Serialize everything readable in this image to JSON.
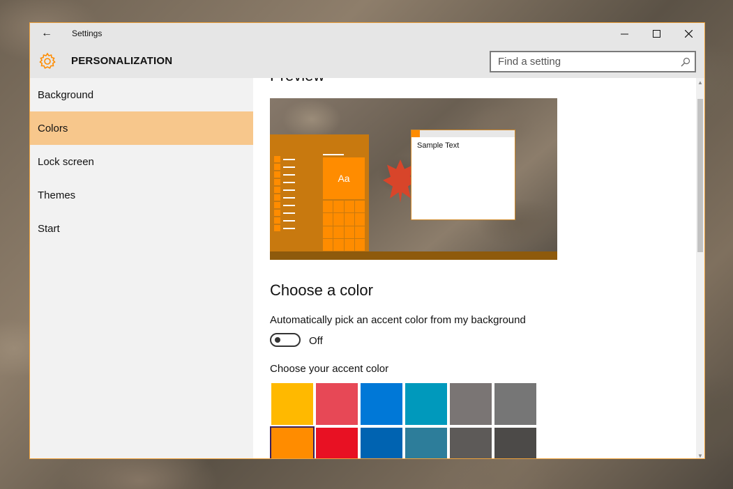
{
  "window": {
    "title": "Settings",
    "back_icon": "←",
    "controls": {
      "minimize": "—",
      "maximize": "☐",
      "close": "✕"
    }
  },
  "header": {
    "section": "PERSONALIZATION",
    "icon": "gear-icon",
    "search_placeholder": "Find a setting"
  },
  "sidebar": {
    "items": [
      {
        "label": "Background"
      },
      {
        "label": "Colors",
        "active": true
      },
      {
        "label": "Lock screen"
      },
      {
        "label": "Themes"
      },
      {
        "label": "Start"
      }
    ]
  },
  "content": {
    "preview_heading": "Preview",
    "preview_tile_text": "Aa",
    "sample_text": "Sample Text",
    "choose_heading": "Choose a color",
    "auto_pick_label": "Automatically pick an accent color from my background",
    "toggle_state": "Off",
    "accent_label": "Choose your accent color"
  },
  "accent_colors": {
    "accent": "#ff8c00",
    "swatches": [
      "#ffb900",
      "#e74856",
      "#0078d7",
      "#0099bc",
      "#7a7574",
      "#767676",
      "#ff8c00",
      "#e81123",
      "#0063b1",
      "#2d7d9a",
      "#5d5a58",
      "#4c4a48"
    ],
    "selected_index": 6
  }
}
